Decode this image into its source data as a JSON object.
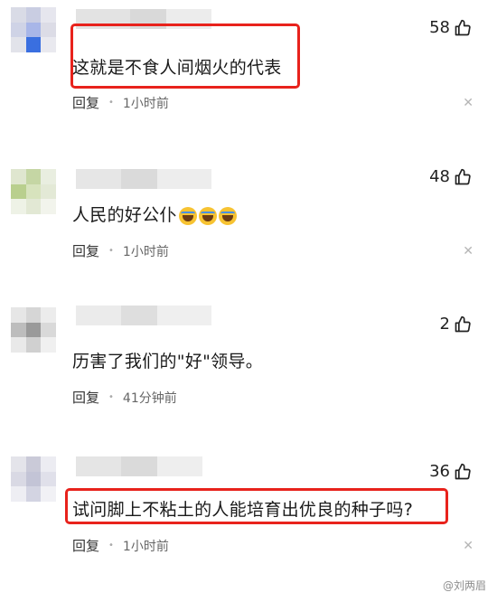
{
  "comments": [
    {
      "likes": "58",
      "text": "这就是不食人间烟火的代表",
      "reply_label": "回复",
      "time": "1小时前",
      "highlighted": true
    },
    {
      "likes": "48",
      "text": "人民的好公仆",
      "reply_label": "回复",
      "time": "1小时前",
      "highlighted": false
    },
    {
      "likes": "2",
      "text": "历害了我们的\"好\"领导。",
      "reply_label": "回复",
      "time": "41分钟前",
      "highlighted": false
    },
    {
      "likes": "36",
      "text": "试问脚上不粘土的人能培育出优良的种子吗?",
      "reply_label": "回复",
      "time": "1小时前",
      "highlighted": true
    }
  ],
  "icons": {
    "like": "thumbs-up-icon",
    "close": "close-icon",
    "emoji": "laughing-crying-emoji-icon"
  },
  "colors": {
    "highlight": "#e8221c",
    "meta_text": "#666666"
  },
  "watermark": "@刘两眉"
}
